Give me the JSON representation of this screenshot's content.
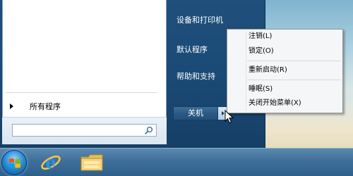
{
  "start_menu": {
    "all_programs_label": "所有程序",
    "search": {
      "value": "",
      "placeholder": ""
    },
    "right_items": [
      {
        "label": "设备和打印机"
      },
      {
        "label": "默认程序"
      },
      {
        "label": "帮助和支持"
      }
    ],
    "shutdown_label": "关机"
  },
  "context_menu": {
    "items": [
      {
        "label": "注销(L)"
      },
      {
        "label": "锁定(O)"
      },
      {
        "label": "重新启动(R)"
      },
      {
        "label": "睡眠(S)"
      },
      {
        "label": "关闭开始菜单(X)"
      }
    ]
  },
  "taskbar": {
    "icons": [
      "windows-logo-icon",
      "internet-explorer-icon",
      "file-explorer-icon"
    ]
  },
  "colors": {
    "start_menu_bg": "#1f4f7a",
    "taskbar_bg": "#3f6f99",
    "menu_bg": "#f5f6f7"
  }
}
